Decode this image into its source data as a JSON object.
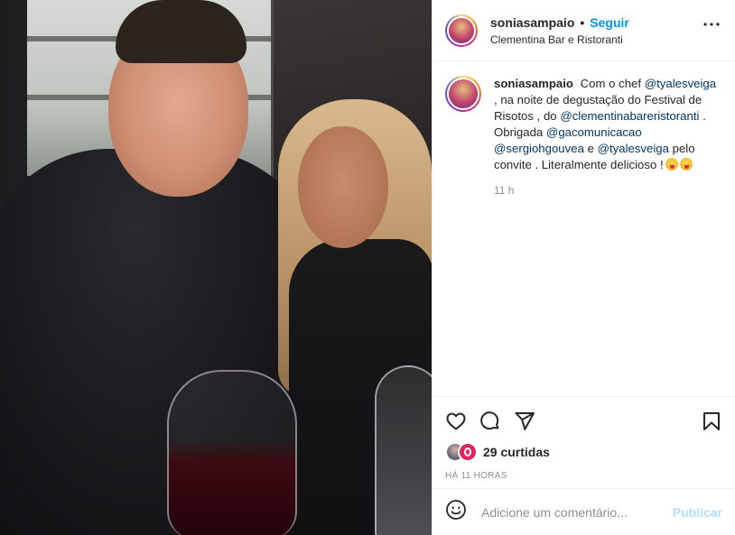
{
  "post": {
    "username": "soniasampaio",
    "separator": "•",
    "follow_label": "Seguir",
    "location": "Clementina Bar e Ristoranti",
    "more_icon": "more-horizontal-icon"
  },
  "caption": {
    "username": "soniasampaio",
    "t1": "Com o chef",
    "m1": "@tyalesveiga",
    "t2": ", na noite de degustação do Festival de Risotos , do",
    "m2": "@clementinabareristoranti",
    "t3": ". Obrigada",
    "m3": "@gacomunicacao",
    "m4": "@sergiohgouvea",
    "t4": "e",
    "m5": "@tyalesveiga",
    "t5": "pelo convite . Literalmente delicioso !",
    "emojis": [
      "face-savoring-food",
      "face-savoring-food"
    ],
    "time": "11 h"
  },
  "actions": {
    "like_icon": "heart-icon",
    "comment_icon": "comment-icon",
    "share_icon": "share-icon",
    "save_icon": "bookmark-icon"
  },
  "likes": {
    "text": "29 curtidas",
    "date": "HÁ 11 HORAS"
  },
  "comment_box": {
    "placeholder": "Adicione um comentário...",
    "publish_label": "Publicar",
    "emoji_icon": "emoji-smile-icon"
  },
  "colors": {
    "link": "#00376b",
    "follow": "#0095f6",
    "muted": "#8e8e8e",
    "publish_disabled": "#b2dffc"
  }
}
